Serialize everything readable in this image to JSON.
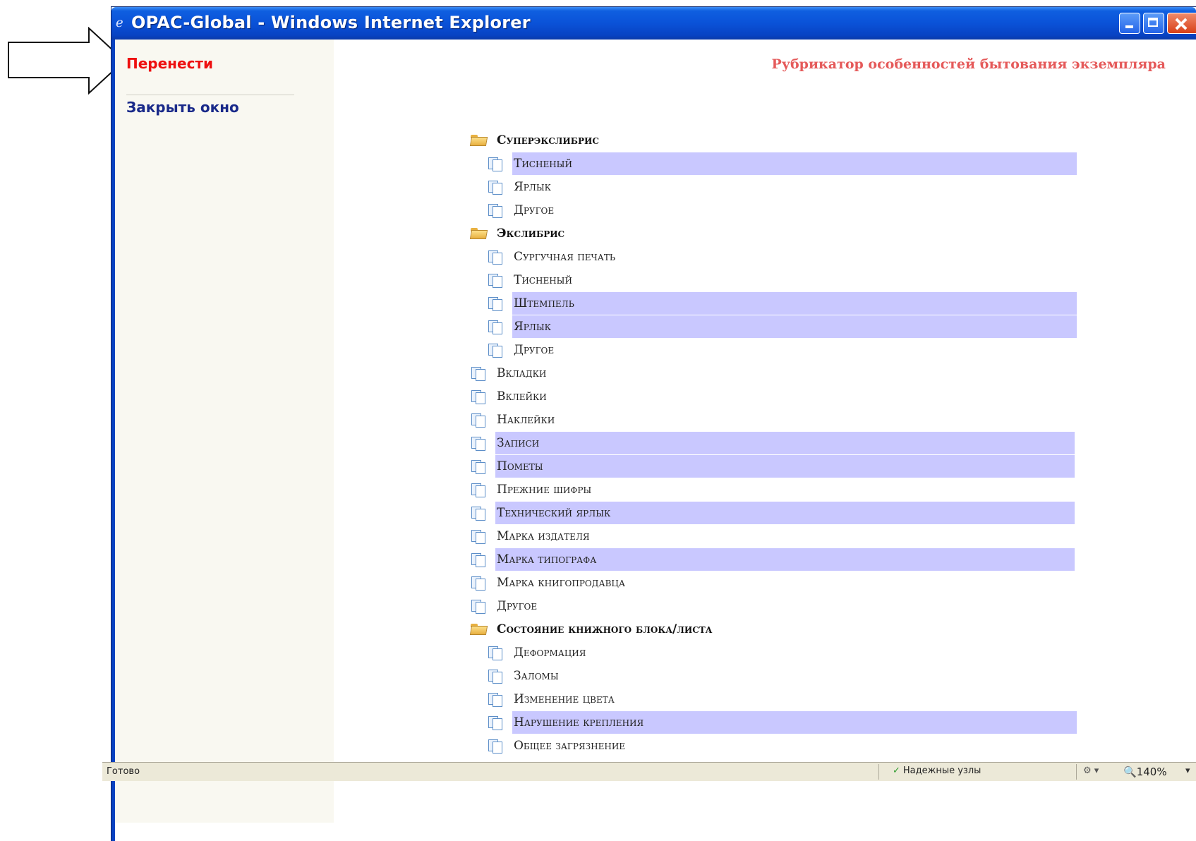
{
  "window": {
    "title": "OPAC-Global - Windows Internet Explorer"
  },
  "sidebar": {
    "move_label": "Перенести",
    "close_label": "Закрыть окно"
  },
  "page": {
    "heading": "Рубрикатор особенностей бытования экземпляра"
  },
  "tree": [
    {
      "label": "Суперэкслибрис",
      "type": "folder",
      "level": 0,
      "selected": false
    },
    {
      "label": "Тисненый",
      "type": "leaf",
      "level": 1,
      "selected": true
    },
    {
      "label": "Ярлык",
      "type": "leaf",
      "level": 1,
      "selected": false
    },
    {
      "label": "Другое",
      "type": "leaf",
      "level": 1,
      "selected": false
    },
    {
      "label": "Экслибрис",
      "type": "folder",
      "level": 0,
      "selected": false
    },
    {
      "label": "Сургучная печать",
      "type": "leaf",
      "level": 1,
      "selected": false
    },
    {
      "label": "Тисненый",
      "type": "leaf",
      "level": 1,
      "selected": false
    },
    {
      "label": "Штемпель",
      "type": "leaf",
      "level": 1,
      "selected": true
    },
    {
      "label": "Ярлык",
      "type": "leaf",
      "level": 1,
      "selected": true
    },
    {
      "label": "Другое",
      "type": "leaf",
      "level": 1,
      "selected": false
    },
    {
      "label": "Вкладки",
      "type": "leaf",
      "level": 0,
      "selected": false
    },
    {
      "label": "Вклейки",
      "type": "leaf",
      "level": 0,
      "selected": false
    },
    {
      "label": "Наклейки",
      "type": "leaf",
      "level": 0,
      "selected": false
    },
    {
      "label": "Записи",
      "type": "leaf",
      "level": 0,
      "selected": true
    },
    {
      "label": "Пометы",
      "type": "leaf",
      "level": 0,
      "selected": true
    },
    {
      "label": "Прежние шифры",
      "type": "leaf",
      "level": 0,
      "selected": false
    },
    {
      "label": "Технический ярлык",
      "type": "leaf",
      "level": 0,
      "selected": true
    },
    {
      "label": "Марка издателя",
      "type": "leaf",
      "level": 0,
      "selected": false
    },
    {
      "label": "Марка типографа",
      "type": "leaf",
      "level": 0,
      "selected": true
    },
    {
      "label": "Марка книгопродавца",
      "type": "leaf",
      "level": 0,
      "selected": false
    },
    {
      "label": "Другое",
      "type": "leaf",
      "level": 0,
      "selected": false
    },
    {
      "label": "Состояние книжного блока/листа",
      "type": "folder",
      "level": 0,
      "selected": false
    },
    {
      "label": "Деформация",
      "type": "leaf",
      "level": 1,
      "selected": false
    },
    {
      "label": "Заломы",
      "type": "leaf",
      "level": 1,
      "selected": false
    },
    {
      "label": "Изменение цвета",
      "type": "leaf",
      "level": 1,
      "selected": false
    },
    {
      "label": "Нарушение крепления",
      "type": "leaf",
      "level": 1,
      "selected": true
    },
    {
      "label": "Общее загрязнение",
      "type": "leaf",
      "level": 1,
      "selected": false
    },
    {
      "label": "",
      "type": "leaf",
      "level": 1,
      "selected": false
    }
  ],
  "statusbar": {
    "status": "Готово",
    "zone": "Надежные узлы",
    "zoom": "140%"
  },
  "colors": {
    "titlebar": "#0a52d8",
    "selection": "#c9c8ff",
    "action_move": "#ee1010",
    "action_close": "#1a2a8a",
    "heading": "#e55a5a"
  },
  "icons": {
    "folder": "folder-open-icon",
    "leaf": "document-icon"
  }
}
